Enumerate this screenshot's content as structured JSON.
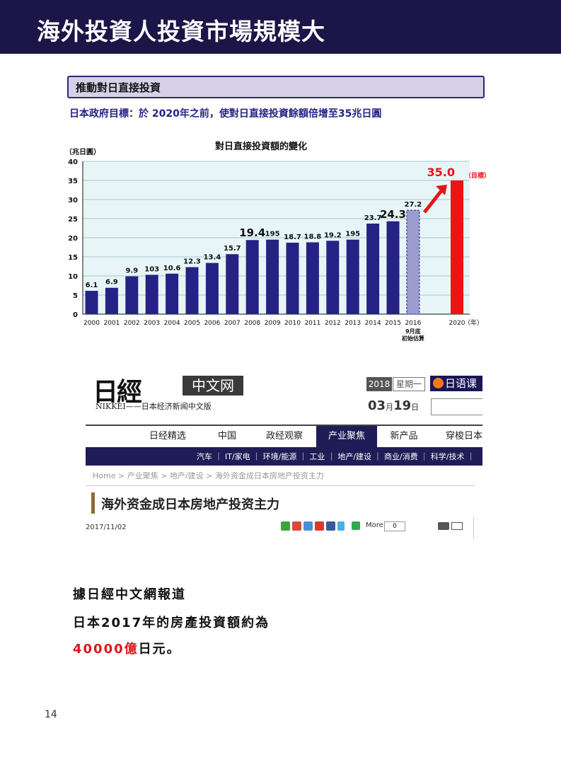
{
  "page": {
    "title": "海外投資人投資市場規模大",
    "page_number": "14"
  },
  "figure": {
    "topic": "推動對日直接投資",
    "goal": "日本政府目標：於 2020年之前，使對日直接投資餘額倍增至35兆日圓",
    "chart_title": "對日直接投資額的變化",
    "unit_label": "（兆日圓）"
  },
  "chart_data": {
    "type": "bar",
    "title": "對日直接投資額的變化",
    "ylabel": "（兆日圓）",
    "xlabel": "（年）",
    "ylim": [
      0,
      40
    ],
    "yticks": [
      0,
      5,
      10,
      15,
      20,
      25,
      30,
      35,
      40
    ],
    "grid": true,
    "categories": [
      "2000",
      "2001",
      "2002",
      "2003",
      "2004",
      "2005",
      "2006",
      "2007",
      "2008",
      "2009",
      "2010",
      "2011",
      "2012",
      "2013",
      "2014",
      "2015",
      "2016",
      "2020"
    ],
    "values": [
      6.1,
      6.9,
      9.9,
      10.3,
      10.6,
      12.3,
      13.4,
      15.7,
      19.4,
      19.5,
      18.7,
      18.8,
      19.2,
      19.5,
      23.7,
      24.3,
      27.2,
      35.0
    ],
    "value_labels": [
      "6.1",
      "6.9",
      "9.9",
      "103",
      "10.6",
      "12.3",
      "13.4",
      "15.7",
      "19.4",
      "195",
      "18.7",
      "18.8",
      "19.2",
      "195",
      "23.7",
      "24.3",
      "27.2",
      "35.0"
    ],
    "bar_colors": [
      "#262285",
      "#262285",
      "#262285",
      "#262285",
      "#262285",
      "#262285",
      "#262285",
      "#262285",
      "#262285",
      "#262285",
      "#262285",
      "#262285",
      "#262285",
      "#262285",
      "#262285",
      "#262285",
      "#9c9cd1",
      "#ee1313"
    ],
    "annotations": {
      "x2016_note": [
        "9月底",
        "初始估算"
      ],
      "target_label": "（目標）",
      "x_unit": "（年）"
    }
  },
  "nikkei": {
    "logo": "日經",
    "logo_box": "中文网",
    "subtitle": "NIKKEI——日本经济新闻中文版",
    "year": "2018",
    "weekday": "星期一",
    "date_month": "03",
    "date_month_unit": "月",
    "date_day": "19",
    "date_day_unit": "日",
    "jp_button": "日语课",
    "nav": [
      "日经精选",
      "中国",
      "政经观察",
      "产业聚焦",
      "新产品",
      "穿梭日本"
    ],
    "nav_active": "产业聚焦",
    "subnav": "汽车 ｜ IT/家电 ｜ 环境/能源 ｜ 工业 ｜ 地产/建设 ｜ 商业/消费 ｜ 科学/技术 ｜",
    "breadcrumb": "Home > 产业聚焦 > 地产/建设 > 海外资金成日本房地产投资主力",
    "article_title": "海外资金成日本房地产投资主力",
    "article_date": "2017/11/02",
    "more_label": "More",
    "share_count": "0"
  },
  "body": {
    "line1": "據日經中文網報道",
    "line2": "日本2017年的房產投資額約為",
    "line3_red": "40000億",
    "line3_black": "日元。"
  }
}
